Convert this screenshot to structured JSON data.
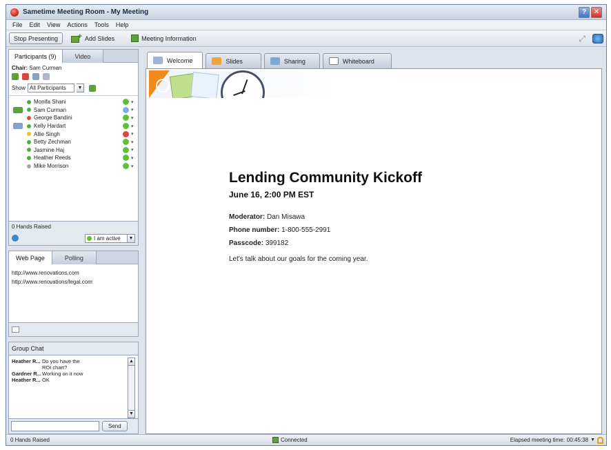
{
  "window": {
    "title": "Sametime Meeting Room - My Meeting"
  },
  "menu": [
    "File",
    "Edit",
    "View",
    "Actions",
    "Tools",
    "Help"
  ],
  "toolbar": {
    "stop_presenting": "Stop Presenting",
    "add_slides": "Add Slides",
    "meeting_info": "Meeting Information"
  },
  "participants_panel": {
    "tabs": [
      "Participants (9)",
      "Video"
    ],
    "chair_label": "Chair:",
    "chair_name": "Sam Curman",
    "show_label": "Show",
    "show_value": "All Participants",
    "participants": [
      {
        "name": "Monifa Shani",
        "dot": "#4caf3c",
        "status": "#5fbf3a"
      },
      {
        "name": "Sam Curman",
        "dot": "#4caf3c",
        "status": "#7ab0e8"
      },
      {
        "name": "George Bandini",
        "dot": "#e04a3a",
        "status": "#5fbf3a"
      },
      {
        "name": "Kelly Hardart",
        "dot": "#4caf3c",
        "status": "#5fbf3a"
      },
      {
        "name": "Allie Singh",
        "dot": "#f0c020",
        "status": "#d94a3a"
      },
      {
        "name": "Betty Zechman",
        "dot": "#4caf3c",
        "status": "#5fbf3a"
      },
      {
        "name": "Jasmine Haj",
        "dot": "#4caf3c",
        "status": "#5fbf3a"
      },
      {
        "name": "Heather Reeds",
        "dot": "#4caf3c",
        "status": "#5fbf3a"
      },
      {
        "name": "Mike Morrison",
        "dot": "#9aa5b8",
        "status": "#5fbf3a"
      }
    ],
    "hands_raised": "0 Hands Raised",
    "active_status": "I am active"
  },
  "web_panel": {
    "tabs": [
      "Web Page",
      "Polling"
    ],
    "urls": [
      "http://www.renovations.com",
      "http://www.renovations/legal.com"
    ]
  },
  "chat_panel": {
    "title": "Group Chat",
    "messages": [
      {
        "user": "Heather R...",
        "text": "Do you have the ROI chart?"
      },
      {
        "user": "Gardner R...",
        "text": "Working on it now"
      },
      {
        "user": "Heather R...",
        "text": "OK"
      }
    ],
    "send_label": "Send"
  },
  "main_tabs": [
    "Welcome",
    "Slides",
    "Sharing",
    "Whiteboard"
  ],
  "welcome": {
    "title": "Lending Community Kickoff",
    "date": "June 16, 2:00 PM EST",
    "moderator_label": "Moderator:",
    "moderator": "Dan Misawa",
    "phone_label": "Phone number:",
    "phone": "1-800-555-2991",
    "passcode_label": "Passcode:",
    "passcode": "399182",
    "message": "Let's talk about our goals for the coming year."
  },
  "status": {
    "hands_raised": "0 Hands Raised",
    "connection": "Connected",
    "elapsed_label": "Elapsed meeting time:",
    "elapsed": "00:45:38"
  }
}
